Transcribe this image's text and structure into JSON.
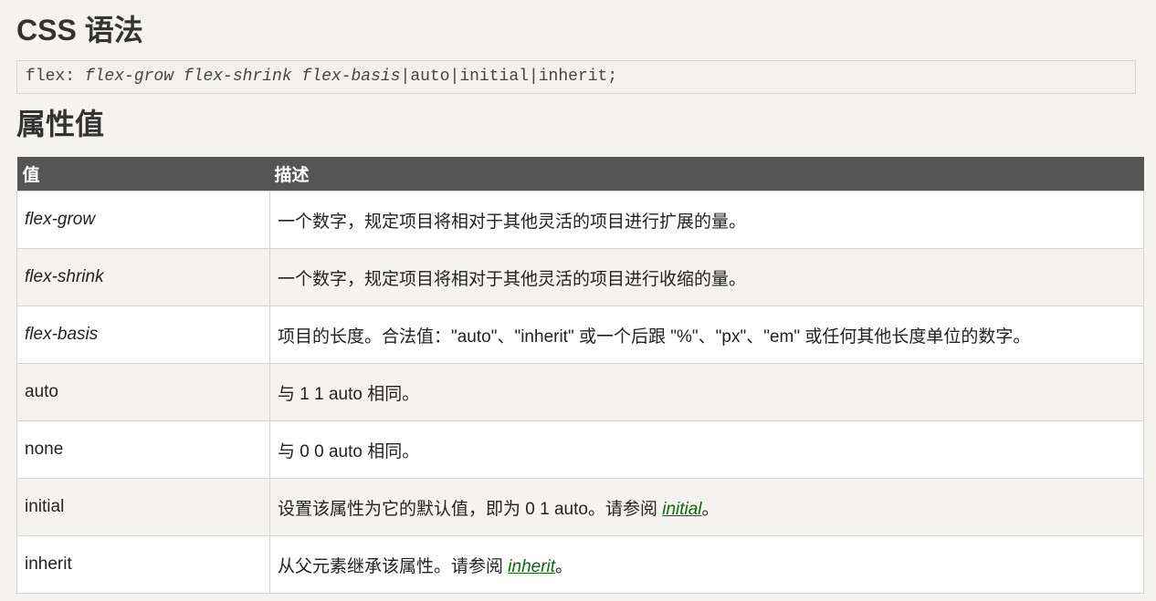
{
  "syntax_title": "CSS 语法",
  "syntax": {
    "prefix": "flex: ",
    "param1": "flex-grow",
    "param2": "flex-shrink",
    "param3": "flex-basis",
    "suffix": "|auto|initial|inherit;"
  },
  "values_title": "属性值",
  "table": {
    "headers": [
      "值",
      "描述"
    ],
    "rows": [
      {
        "value": "flex-grow",
        "desc": "一个数字，规定项目将相对于其他灵活的项目进行扩展的量。"
      },
      {
        "value": "flex-shrink",
        "desc": "一个数字，规定项目将相对于其他灵活的项目进行收缩的量。"
      },
      {
        "value": "flex-basis",
        "desc": "项目的长度。合法值：\"auto\"、\"inherit\" 或一个后跟 \"%\"、\"px\"、\"em\" 或任何其他长度单位的数字。"
      },
      {
        "value": "auto",
        "desc": "与 1 1 auto 相同。"
      },
      {
        "value": "none",
        "desc": "与 0 0 auto 相同。"
      },
      {
        "value": "initial",
        "desc_pre": "设置该属性为它的默认值，即为 0 1 auto。请参阅 ",
        "link": "initial",
        "desc_post": "。"
      },
      {
        "value": "inherit",
        "desc_pre": "从父元素继承该属性。请参阅 ",
        "link": "inherit",
        "desc_post": "。"
      }
    ]
  },
  "colors": {
    "header_bg": "#555555",
    "link": "#0a6b0a",
    "row_alt": "#f4f3f0"
  }
}
